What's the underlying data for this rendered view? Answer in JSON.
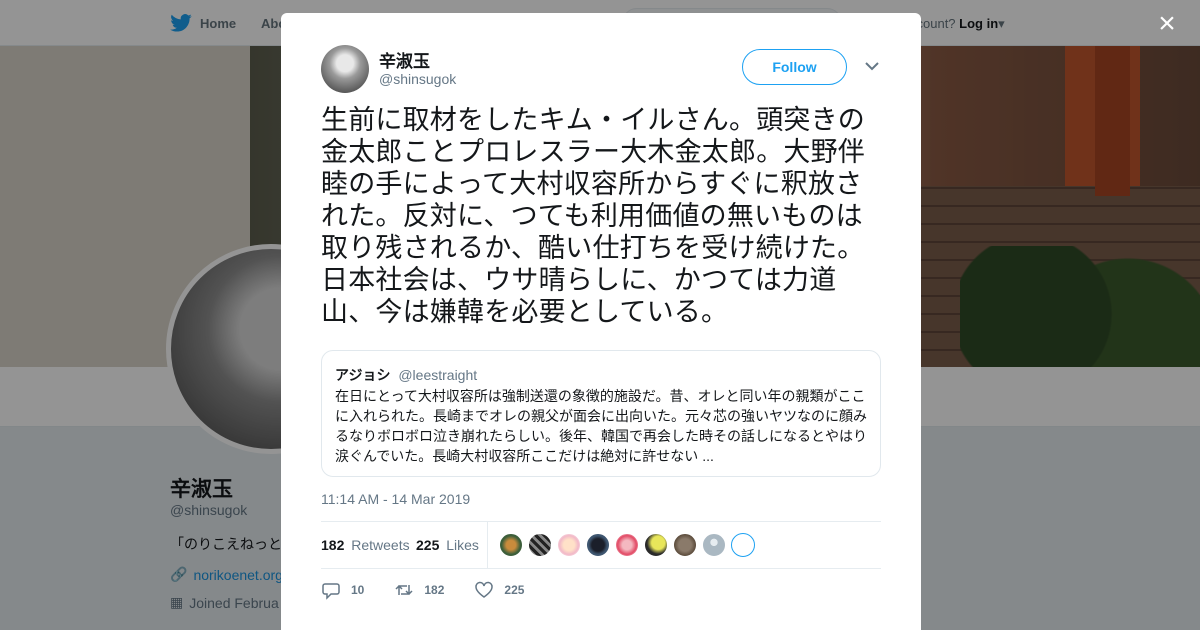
{
  "background": {
    "nav": {
      "home": "Home",
      "about": "Abo"
    },
    "login": {
      "prompt": "ccount?",
      "label": "Log in"
    },
    "profile": {
      "name": "辛淑玉",
      "handle": "@shinsugok",
      "bio": "「のりこえねっと",
      "link": "norikoenet.org",
      "joined": "Joined Februa"
    }
  },
  "close_label": "×",
  "tweet": {
    "author": {
      "name": "辛淑玉",
      "handle": "@shinsugok"
    },
    "follow_label": "Follow",
    "text_lines": [
      "生前に取材をしたキム・イルさん。頭突きの",
      "金太郎ことプロレスラー大木金太郎。大野伴",
      "睦の手によって大村収容所からすぐに釈放さ",
      "れた。反対に、つても利用価値の無いものは",
      "取り残されるか、酷い仕打ちを受け続けた。",
      "日本社会は、ウサ晴らしに、かつては力道",
      "山、今は嫌韓を必要としている。"
    ],
    "quote": {
      "name": "アジョシ",
      "handle": "@leestraight",
      "lines": [
        "在日にとって大村収容所は強制送還の象徴的施設だ。昔、オレと同い年の親類がここ",
        "に入れられた。長崎までオレの親父が面会に出向いた。元々芯の強いヤツなのに顔み",
        "るなりボロボロ泣き崩れたらしい。後年、韓国で再会した時その話しになるとやはり",
        "涙ぐんでいた。長崎大村収容所ここだけは絶対に許せない ..."
      ]
    },
    "timestamp": "11:14 AM - 14 Mar 2019",
    "stats": {
      "retweets_count": "182",
      "retweets_label": "Retweets",
      "likes_count": "225",
      "likes_label": "Likes"
    },
    "actions": {
      "reply_count": "10",
      "retweet_count": "182",
      "like_count": "225"
    }
  },
  "colors": {
    "accent": "#1da1f2",
    "muted": "#657786",
    "text": "#14171a"
  }
}
